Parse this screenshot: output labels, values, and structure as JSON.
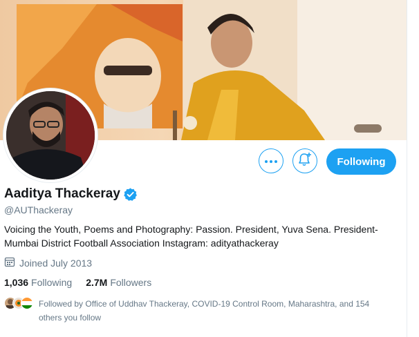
{
  "profile": {
    "name": "Aaditya Thackeray",
    "handle": "@AUThackeray",
    "bio_lines": [
      "Voicing the Youth, Poems and Photography: Passion. President, Yuva Sena. President-",
      "Mumbai District Football Association Instagram: adityathackeray"
    ],
    "joined": "Joined July 2013",
    "following_count": "1,036",
    "following_label": "Following",
    "followers_count": "2.7M",
    "followers_label": "Followers",
    "followed_by_lines": [
      "Followed by Office of Uddhav Thackeray, COVID-19 Control Room, Maharashtra, and 154",
      "others you follow"
    ]
  },
  "actions": {
    "more_icon": "more-horizontal-icon",
    "notify_icon": "bell-plus-icon",
    "follow_label": "Following"
  },
  "colors": {
    "accent": "#1da1f2",
    "secondary_text": "#657786"
  }
}
